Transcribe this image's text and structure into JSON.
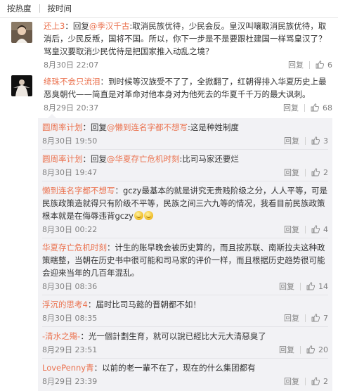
{
  "sort": {
    "hot": "按热度",
    "time": "按时间"
  },
  "top_comments": [
    {
      "user": "还上3",
      "prefix": "：回复",
      "mention": "@季汉千古",
      "text": ":取消民族优待，少民会反。皇汉叫嚷取消民族优待，取消后，少民反叛，国将不国。所以，你下一步是不是要跟杜建国一样骂皇汉了？骂皇汉要取消少民优待是把国家推入动乱之境？",
      "time": "8月30日 22:07",
      "reply": "回复",
      "likes": "6"
    },
    {
      "user": "绛珠不会只流泪",
      "prefix": "：",
      "mention": "",
      "text": "到时候等汉族受不了了，全掀翻了，红朝得排入华夏历史上最恶臭朝代——简直是对革命对他本身对为他死去的华夏千千万的最大讽刺。",
      "time": "8月29日 20:37",
      "reply": "回复",
      "likes": "68"
    }
  ],
  "sub_replies": [
    {
      "user": "圆周率计划",
      "prefix": "：回复",
      "mention": "@懒到连名字都不想写",
      "text": ":这是种姓制度",
      "time": "8月30日 19:50",
      "reply": "回复",
      "likes": "3"
    },
    {
      "user": "圆周率计划",
      "prefix": "：回复",
      "mention": "@华夏存亡危机时刻",
      "text": ":比司马家还要烂",
      "time": "8月30日 19:47",
      "reply": "回复",
      "likes": "2"
    },
    {
      "user": "懒到连名字都不想写",
      "prefix": "：",
      "mention": "",
      "text": "gczy最基本的就是讲究无贵贱阶级之分，人人平等，可是民族政策造就得只有阶级不平等，民族之间三六九等的情况，我看目前民族政策根本就是在侮辱违背gczy",
      "emoji": true,
      "time": "8月30日 00:22",
      "reply": "回复",
      "likes": "4"
    },
    {
      "user": "华夏存亡危机时刻",
      "prefix": "：",
      "mention": "",
      "text": "计生的账早晚会被历史算的，而且按苏联、南斯拉夫这种政策瞎整，当朝在历史书中很可能和司马家的评价一样，而且根据历史趋势很可能会迎来当年的几百年混乱。",
      "time": "8月30日 08:36",
      "reply": "回复",
      "likes": "14"
    },
    {
      "user": "浮沉的思考4",
      "prefix": "：",
      "mention": "",
      "text": "届时比司马懿的晋朝都不如！",
      "time": "8月30日 08:35",
      "reply": "回复",
      "likes": "7"
    },
    {
      "user": "-清水之殤-",
      "prefix": "：",
      "mention": "",
      "text": "光一個計劃生育，就可以說已經比大元大清惡臭了",
      "time": "8月29日 23:51",
      "reply": "回复",
      "likes": "20"
    },
    {
      "user": "LovePenny青",
      "prefix": "：",
      "mention": "",
      "text": "以前的老一輩不在了，现在的什么集团都有",
      "time": "8月29日 23:39",
      "reply": "回复",
      "likes": "2"
    }
  ],
  "colors": {
    "username": "#eb7350",
    "muted": "#808080",
    "sub_bg": "#f2f2f5"
  },
  "icons": {
    "like": "thumbs-up-icon"
  }
}
